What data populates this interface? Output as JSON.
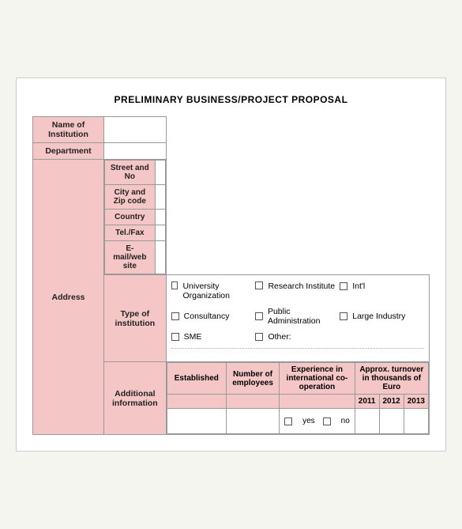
{
  "title": "PRELIMINARY BUSINESS/PROJECT PROPOSAL",
  "rows": [
    {
      "label": "Name of\nInstitution",
      "value": ""
    },
    {
      "label": "Department",
      "value": ""
    }
  ],
  "address": {
    "main_label": "Address",
    "sub_rows": [
      {
        "label": "Street and No",
        "value": ""
      },
      {
        "label": "City and Zip code",
        "value": ""
      },
      {
        "label": "Country",
        "value": ""
      },
      {
        "label": "Tel./Fax",
        "value": ""
      },
      {
        "label": "E-mail/web site",
        "value": ""
      }
    ]
  },
  "type_institution": {
    "main_label": "Type of\ninstitution",
    "options": [
      {
        "col": 0,
        "label": "University Organization"
      },
      {
        "col": 1,
        "label": "Research Institute"
      },
      {
        "col": 2,
        "label": "Int'l"
      },
      {
        "col": 0,
        "label": "Consultancy"
      },
      {
        "col": 1,
        "label": "Public Administration"
      },
      {
        "col": 2,
        "label": "Large Industry"
      },
      {
        "col": 0,
        "label": "SME"
      },
      {
        "col": 1,
        "label": "Other:"
      }
    ]
  },
  "additional": {
    "main_label": "Additional\ninformation",
    "col_headers": [
      "Established",
      "Number of employees",
      "Experience in international co-operation",
      "Approx. turnover in thousands of Euro"
    ],
    "year_headers": [
      "2011",
      "2012",
      "2013"
    ],
    "yes_label": "yes",
    "no_label": "no"
  }
}
